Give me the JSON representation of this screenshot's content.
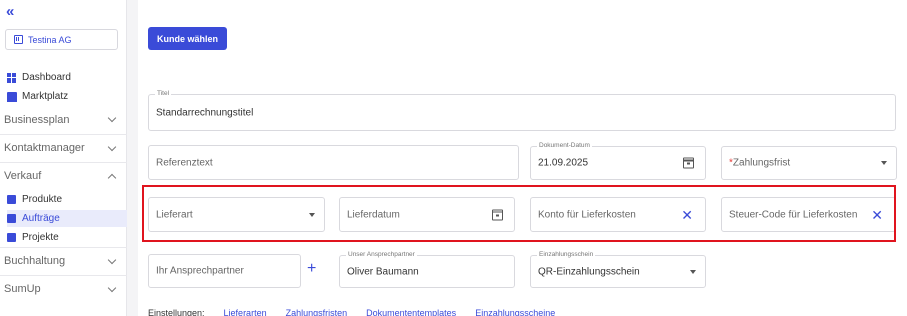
{
  "sidebar": {
    "collapse_glyph": "«",
    "company": "Testina AG",
    "top_items": [
      "Dashboard",
      "Marktplatz"
    ],
    "sections": [
      "Businessplan",
      "Kontaktmanager",
      "Verkauf",
      "Buchhaltung",
      "SumUp"
    ],
    "verkauf_items": [
      "Produkte",
      "Aufträge",
      "Projekte"
    ]
  },
  "main": {
    "select_customer_button": "Kunde wählen",
    "title_field": {
      "label": "Titel",
      "value": "Standarrechnungstitel"
    },
    "reference_placeholder": "Referenztext",
    "document_date": {
      "label": "Dokument-Datum",
      "value": "21.09.2025"
    },
    "payment_term": {
      "required_mark": "*",
      "placeholder": "Zahlungsfrist"
    },
    "delivery_type_placeholder": "Lieferart",
    "delivery_date_placeholder": "Lieferdatum",
    "delivery_cost_account_placeholder": "Konto für Lieferkosten",
    "delivery_cost_tax_code_placeholder": "Steuer-Code für Lieferkosten",
    "contact_placeholder": "Ihr Ansprechpartner",
    "our_contact": {
      "label": "Unser Ansprechpartner",
      "value": "Oliver Baumann"
    },
    "payment_slip": {
      "label": "Einzahlungsschein",
      "value": "QR-Einzahlungsschein"
    },
    "settings": {
      "label": "Einstellungen:",
      "links": [
        "Lieferarten",
        "Zahlungsfristen",
        "Dokumententemplates",
        "Einzahlungsscheine"
      ]
    }
  },
  "colors": {
    "accent": "#3a4bd8",
    "highlight": "#e0141e"
  }
}
